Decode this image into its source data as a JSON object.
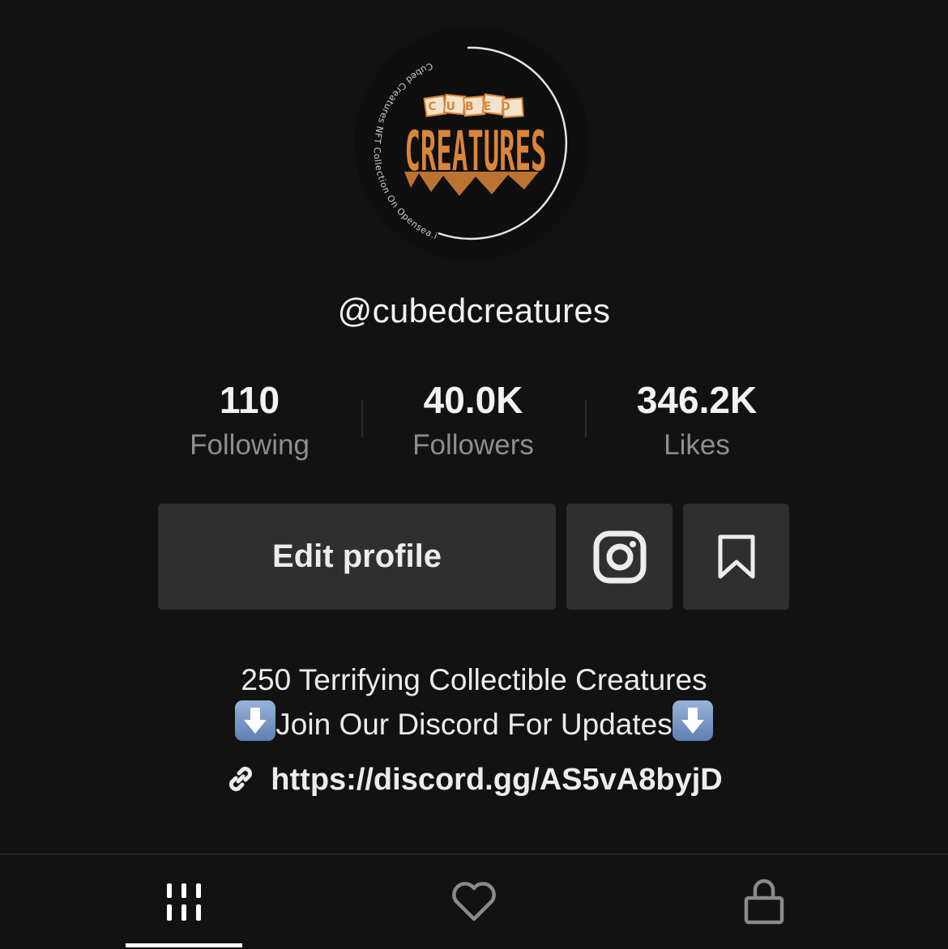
{
  "profile": {
    "username": "@cubedcreatures",
    "avatar": {
      "ring_text": "Cubed Creatures NFT Collection On Opensea.io",
      "logo_top": "CUBED",
      "logo_main": "CREATURES",
      "logo_color": "#d9853b"
    }
  },
  "stats": [
    {
      "value": "110",
      "label": "Following"
    },
    {
      "value": "40.0K",
      "label": "Followers"
    },
    {
      "value": "346.2K",
      "label": "Likes"
    }
  ],
  "actions": {
    "edit_label": "Edit profile",
    "instagram_icon": "instagram-icon",
    "favorites_icon": "bookmark-icon"
  },
  "bio": {
    "line1": "250 Terrifying Collectible Creatures",
    "line2": "Join Our Discord For Updates"
  },
  "link": {
    "url": "https://discord.gg/AS5vA8byjD",
    "icon": "link-icon"
  },
  "tabs": [
    {
      "name": "videos",
      "icon": "grid-icon",
      "active": true
    },
    {
      "name": "liked",
      "icon": "heart-icon",
      "active": false
    },
    {
      "name": "private",
      "icon": "lock-icon",
      "active": false
    }
  ],
  "colors": {
    "background": "#121212",
    "button": "#2f2f2f",
    "secondary_text": "#8e8e8e"
  }
}
